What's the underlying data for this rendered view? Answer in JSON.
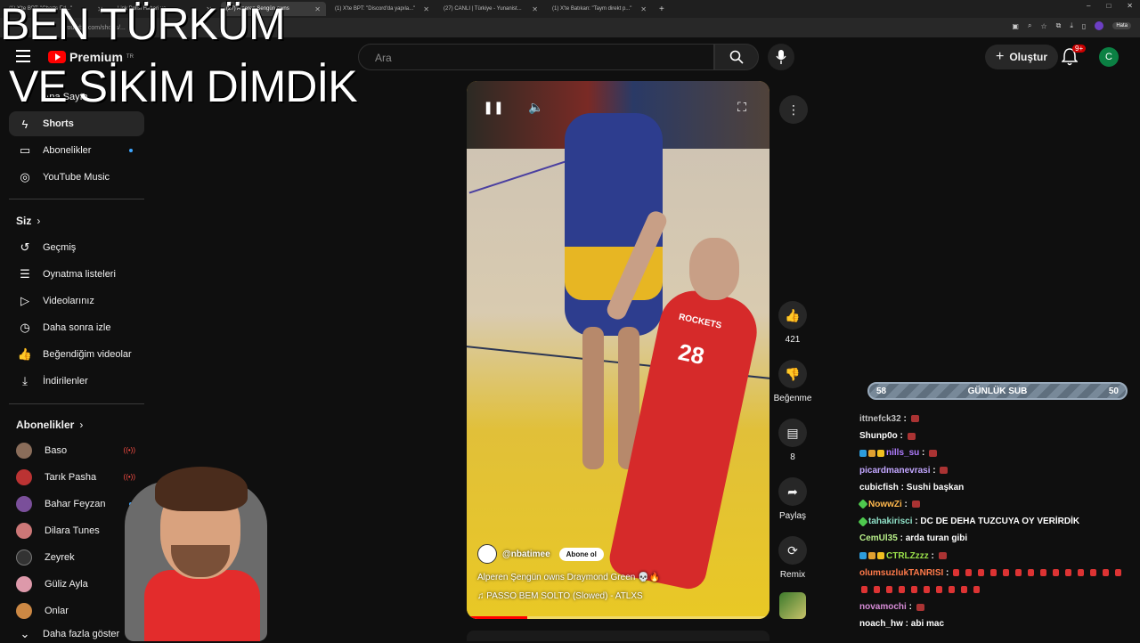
{
  "overlay": {
    "line1": "BEN TÜRKÜM",
    "line2": "VE SİKİM DİMDİK"
  },
  "browser": {
    "tabs": [
      {
        "label": "(1) X'te BPT: \"Charts Ed...\""
      },
      {
        "label": "Link Polisi Haberi vo..."
      },
      {
        "label": "(27) Alperen Şengün owns",
        "active": true
      },
      {
        "label": "(1) X'te BPT: \"Discord'da yapıla...\""
      },
      {
        "label": "(27) CANLI | Türkiye - Yunanist..."
      },
      {
        "label": "(1) X'te Batıkan: \"Taym direkt p...\""
      }
    ],
    "new_tab": "+",
    "url": "youtube.com/shorts/...",
    "error_chip": "Hata",
    "window_controls": [
      "–",
      "□",
      "✕"
    ]
  },
  "header": {
    "logo": "Premium",
    "logo_region": "TR",
    "search_placeholder": "Ara",
    "create_label": "Oluştur",
    "notification_badge": "9+",
    "user_initial": "C"
  },
  "sidebar": {
    "top": [
      {
        "label": "Ana Sayfa",
        "icon": "home-icon"
      },
      {
        "label": "Shorts",
        "icon": "shorts-icon",
        "active": true
      },
      {
        "label": "Abonelikler",
        "icon": "subscriptions-icon",
        "dot": true
      },
      {
        "label": "YouTube Music",
        "icon": "music-icon"
      }
    ],
    "you_header": "Siz",
    "you": [
      {
        "label": "Geçmiş",
        "icon": "history-icon"
      },
      {
        "label": "Oynatma listeleri",
        "icon": "playlist-icon"
      },
      {
        "label": "Videolarınız",
        "icon": "your-videos-icon"
      },
      {
        "label": "Daha sonra izle",
        "icon": "watch-later-icon"
      },
      {
        "label": "Beğendiğim videolar",
        "icon": "like-icon"
      },
      {
        "label": "İndirilenler",
        "icon": "download-icon"
      }
    ],
    "subs_header": "Abonelikler",
    "subs": [
      {
        "label": "Baso",
        "live": true,
        "color": "#8a6d5a"
      },
      {
        "label": "Tarık Pasha",
        "live": true,
        "color": "#b33"
      },
      {
        "label": "Bahar Feyzan",
        "dot": true,
        "color": "#7a4f9a"
      },
      {
        "label": "Dilara Tunes",
        "dot": true,
        "color": "#c77"
      },
      {
        "label": "Zeyrek",
        "dot": false,
        "color": "#333"
      },
      {
        "label": "Güliz Ayla",
        "dot": true,
        "color": "#d9a"
      },
      {
        "label": "Onlar",
        "dot": true,
        "color": "#c84"
      }
    ],
    "show_more": "Daha fazla göster"
  },
  "short": {
    "jersey_team": "ROCKETS",
    "jersey_number": "28",
    "channel": "@nbatimee",
    "subscribe_label": "Abone ol",
    "caption": "Alperen Şengün owns Draymond Green 💀🔥",
    "music": "♫ PASSO BEM SOLTO (Slowed) - ATLXS",
    "progress": 0.2
  },
  "actions": {
    "like_count": "421",
    "dislike_label": "Beğenme",
    "comment_count": "8",
    "share_label": "Paylaş",
    "remix_label": "Remix"
  },
  "subgoal": {
    "left": "58",
    "title": "GÜNLÜK SUB",
    "right": "50"
  },
  "chat": [
    {
      "user": "ittnefck32",
      "color": "#c0c0c0",
      "text": "",
      "emote": true
    },
    {
      "user": "Shunp0o",
      "color": "#ffffff",
      "text": "",
      "emote": true
    },
    {
      "user": "nills_su",
      "color": "#b07cff",
      "text": "",
      "emote": true,
      "badges": true
    },
    {
      "user": "picardmanevrasi",
      "color": "#c2a6ff",
      "text": "",
      "emote": true
    },
    {
      "user": "cubicfish",
      "color": "#ffffff",
      "text": "Sushi başkan"
    },
    {
      "user": "NowwZi",
      "color": "#ffb84d",
      "text": "",
      "emote": true,
      "badge_green": true
    },
    {
      "user": "tahakirisci",
      "color": "#8fe0c7",
      "text": "DC DE DEHA TUZCUYA OY VERİRDİK",
      "badge_green": true
    },
    {
      "user": "CemUl35",
      "color": "#b9f08a",
      "text": "arda turan gibi"
    },
    {
      "user": "CTRLZzzz",
      "color": "#9ae04a",
      "text": "",
      "emote": true,
      "badges": true
    },
    {
      "user": "olumsuzlukTANRISI",
      "color": "#ff7a4a",
      "text": "",
      "flags": 24
    },
    {
      "user": "novamochi",
      "color": "#d78cd7",
      "text": "",
      "emote": true
    },
    {
      "user": "noach_hw",
      "color": "#ffffff",
      "text": "abi mac"
    }
  ]
}
